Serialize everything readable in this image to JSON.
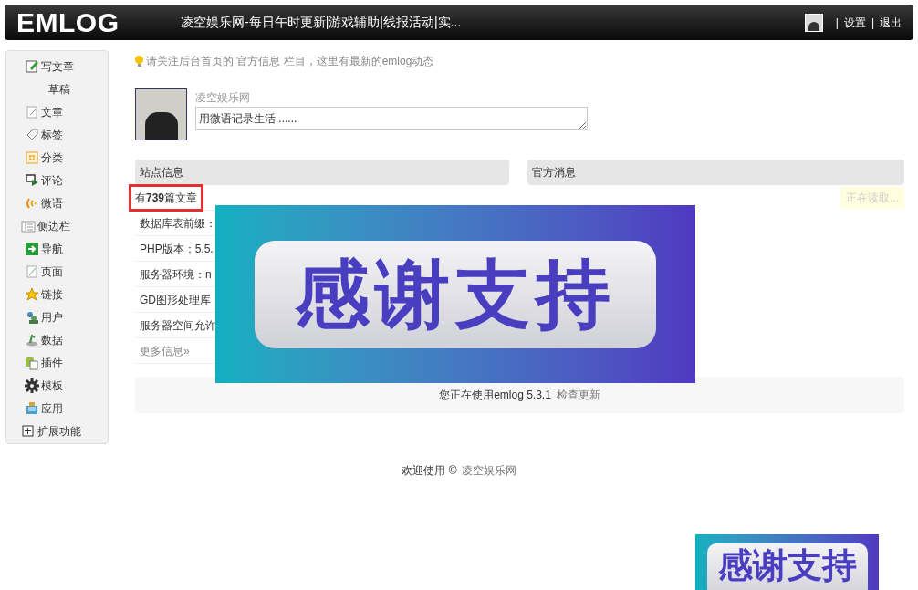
{
  "header": {
    "logo": "EMLOG",
    "site_title": "凌空娱乐网-每日午时更新|游戏辅助|线报活动|实...",
    "links": [
      {
        "label": "设置"
      },
      {
        "label": "退出"
      }
    ],
    "separator": "|"
  },
  "sidebar": {
    "items": [
      {
        "label": "写文章"
      },
      {
        "label": "草稿"
      },
      {
        "label": "文章"
      },
      {
        "label": "标签"
      },
      {
        "label": "分类"
      },
      {
        "label": "评论"
      },
      {
        "label": "微语"
      },
      {
        "label": "侧边栏"
      },
      {
        "label": "导航"
      },
      {
        "label": "页面"
      },
      {
        "label": "链接"
      },
      {
        "label": "用户"
      },
      {
        "label": "数据"
      },
      {
        "label": "插件"
      },
      {
        "label": "模板"
      },
      {
        "label": "应用"
      },
      {
        "label": "扩展功能"
      }
    ]
  },
  "notice": "请关注后台首页的 官方信息 栏目，这里有最新的emlog动态",
  "twitter": {
    "name": "凌空娱乐网",
    "placeholder": "用微语记录生活 ......"
  },
  "site_info": {
    "title": "站点信息",
    "rows": [
      {
        "text": "有**739**篇文章",
        "highlighted": true
      },
      {
        "text": "数据库表前缀：",
        "highlighted": false
      },
      {
        "text": "PHP版本：5.5.",
        "highlighted": false
      },
      {
        "text": "服务器环境：n",
        "highlighted": false
      },
      {
        "text": "GD图形处理库",
        "highlighted": false
      },
      {
        "text": "服务器空间允许",
        "highlighted": false
      }
    ],
    "more": "更多信息»"
  },
  "official": {
    "title": "官方消息",
    "loading": "正在读取..."
  },
  "version_bar": {
    "text": "您正在使用emlog 5.3.1",
    "link": "检查更新"
  },
  "footer": {
    "text": "欢迎使用 ©",
    "link": "凌空娱乐网"
  },
  "banners": [
    {
      "text": "感谢支持"
    },
    {
      "text": "感谢支持"
    }
  ]
}
